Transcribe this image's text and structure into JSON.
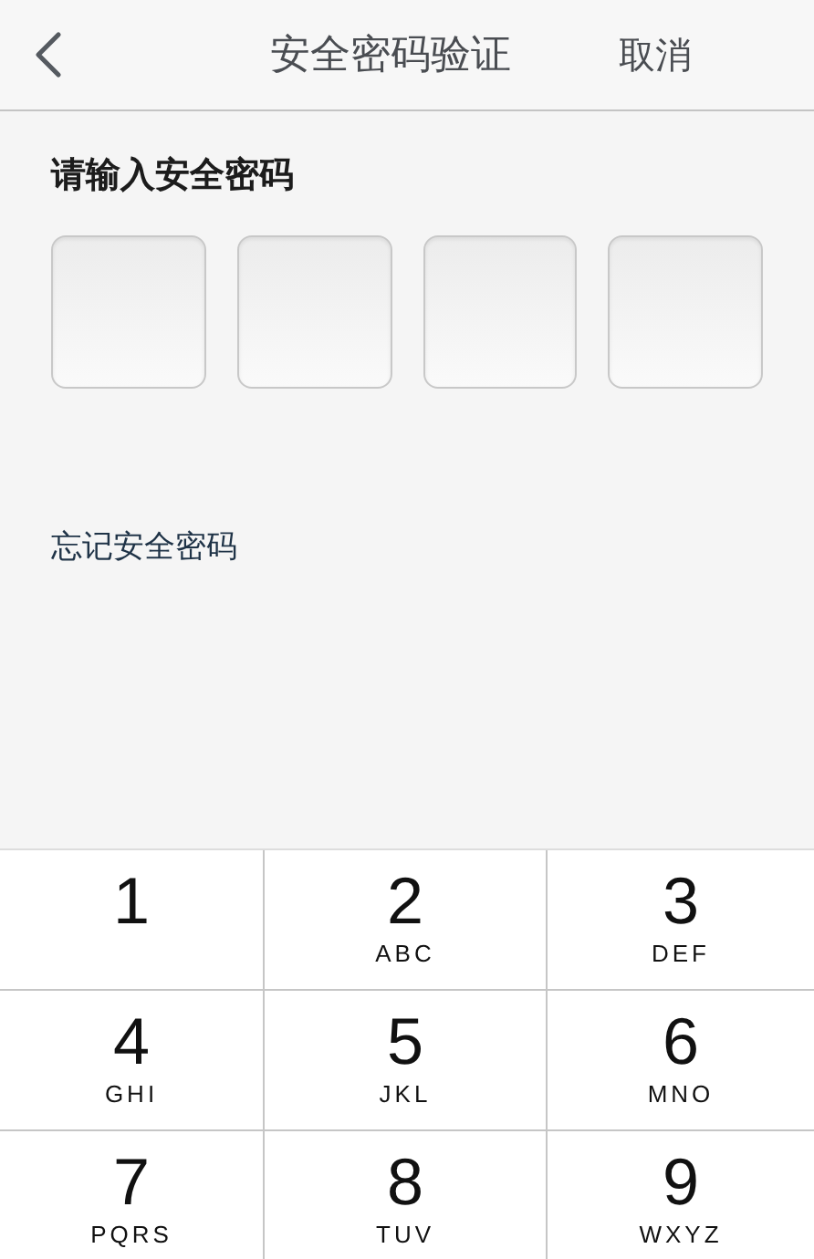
{
  "nav_bar": {
    "title": "安全密码验证",
    "cancel": "取消"
  },
  "prompt": "请输入安全密码",
  "pin_boxes": [
    {
      "filled": false
    },
    {
      "filled": false
    },
    {
      "filled": false
    },
    {
      "filled": false
    }
  ],
  "forgot_link": "忘记安全密码",
  "keypad": [
    {
      "digit": "1"
    },
    {
      "digit": "2",
      "letters": "ABC"
    },
    {
      "digit": "3",
      "letters": "DEF"
    },
    {
      "digit": "4",
      "letters": "GHI"
    },
    {
      "digit": "5",
      "letters": "JKL"
    },
    {
      "digit": "6",
      "letters": "MNO"
    },
    {
      "digit": "7",
      "letters": "PQRS"
    },
    {
      "digit": "8",
      "letters": "TUV"
    },
    {
      "digit": "9",
      "letters": "WXYZ"
    }
  ]
}
